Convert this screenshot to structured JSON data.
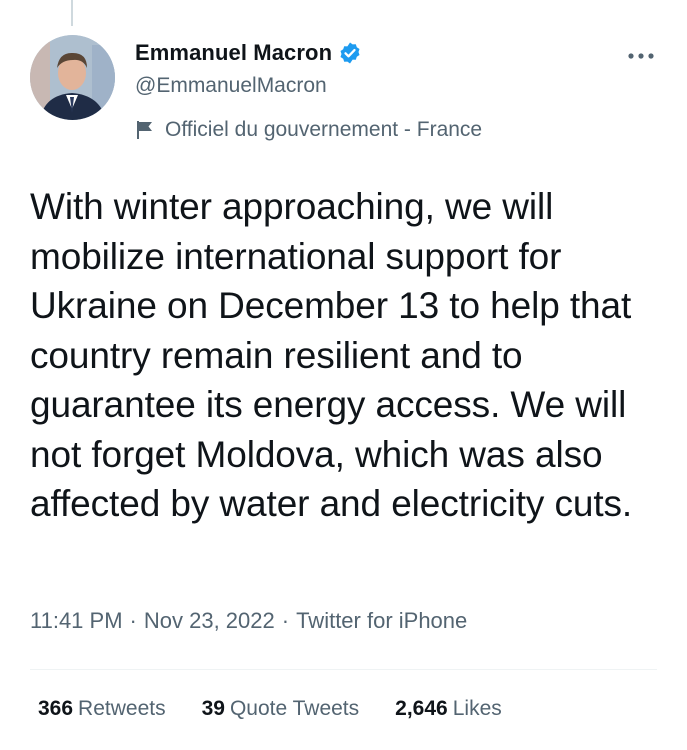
{
  "tweet": {
    "author": {
      "display_name": "Emmanuel Macron",
      "handle": "@EmmanuelMacron",
      "verified": true,
      "avatar_icon": "profile-photo"
    },
    "account_label": "Officiel du gouvernement - France",
    "account_label_icon": "government-flag-icon",
    "more_icon": "more-dots-icon",
    "text": "With winter approaching, we will mobilize international support for Ukraine on December 13 to help that country remain resilient and to guarantee its energy access. We will not forget Moldova, which was also affected by water and electricity cuts.",
    "meta": {
      "time": "11:41 PM",
      "date": "Nov 23, 2022",
      "source": "Twitter for iPhone",
      "separator": "·"
    },
    "stats": {
      "retweets_count": "366",
      "retweets_label": "Retweets",
      "quote_tweets_count": "39",
      "quote_tweets_label": "Quote Tweets",
      "likes_count": "2,646",
      "likes_label": "Likes"
    }
  },
  "colors": {
    "text_primary": "#0f1419",
    "text_secondary": "#536471",
    "verified_blue": "#1d9bf0",
    "divider": "#eff3f4"
  }
}
